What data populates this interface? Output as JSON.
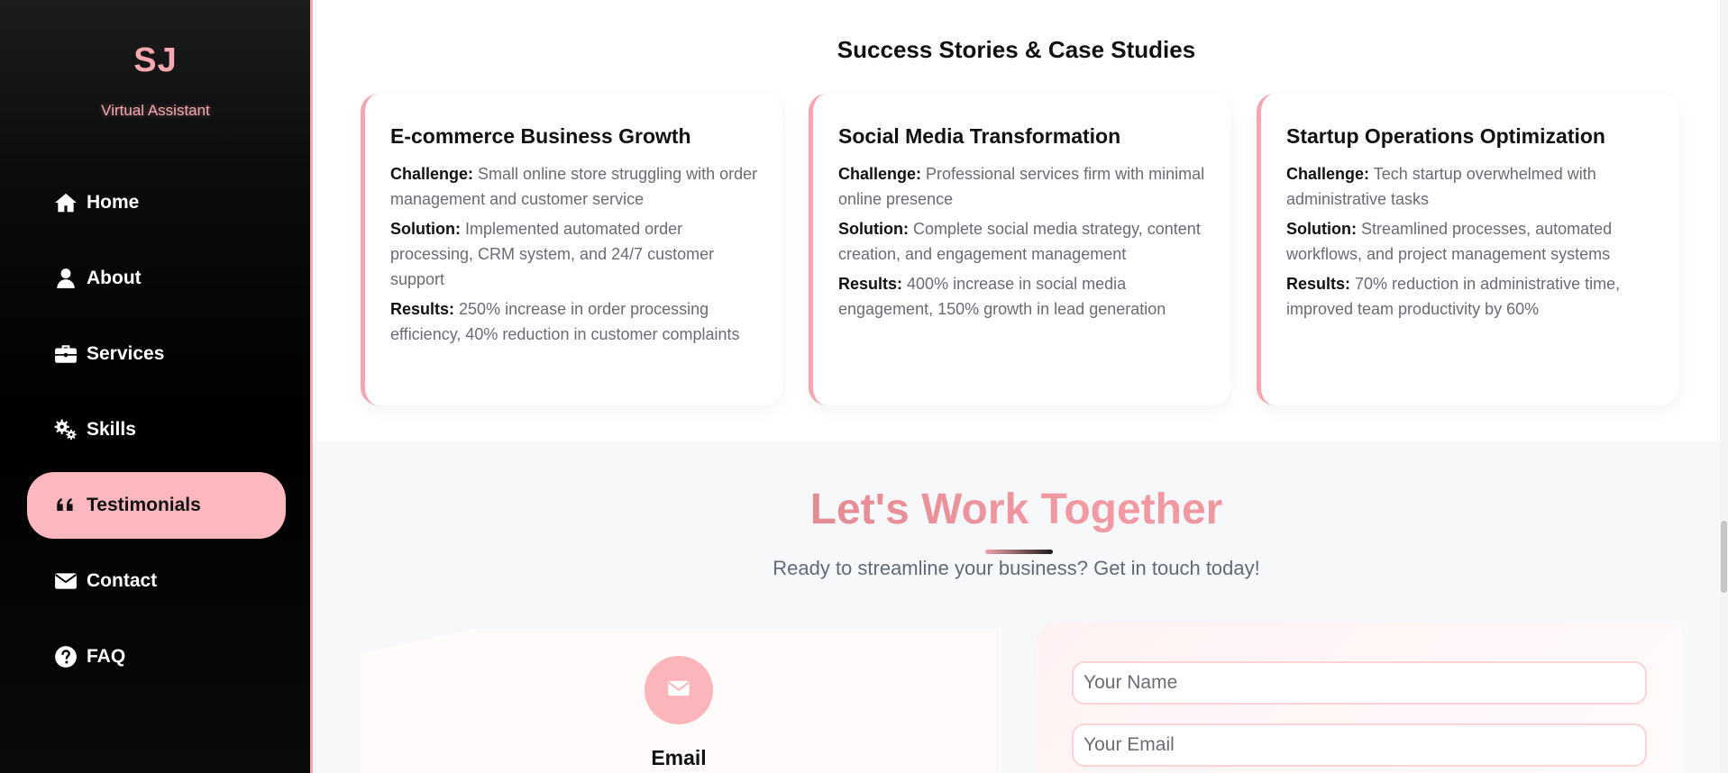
{
  "sidebar": {
    "logo": "SJ",
    "subtitle": "Virtual Assistant",
    "items": [
      {
        "label": "Home",
        "icon": "home-icon"
      },
      {
        "label": "About",
        "icon": "user-icon"
      },
      {
        "label": "Services",
        "icon": "briefcase-icon"
      },
      {
        "label": "Skills",
        "icon": "gears-icon"
      },
      {
        "label": "Testimonials",
        "icon": "quote-icon",
        "active": true
      },
      {
        "label": "Contact",
        "icon": "envelope-icon"
      },
      {
        "label": "FAQ",
        "icon": "question-circle-icon"
      }
    ]
  },
  "case_studies": {
    "title": "Success Stories & Case Studies",
    "cards": [
      {
        "title": "E-commerce Business Growth",
        "challenge_label": "Challenge:",
        "challenge": "Small online store struggling with order management and customer service",
        "solution_label": "Solution:",
        "solution": "Implemented automated order processing, CRM system, and 24/7 customer support",
        "results_label": "Results:",
        "results": "250% increase in order processing efficiency, 40% reduction in customer complaints"
      },
      {
        "title": "Social Media Transformation",
        "challenge_label": "Challenge:",
        "challenge": "Professional services firm with minimal online presence",
        "solution_label": "Solution:",
        "solution": "Complete social media strategy, content creation, and engagement management",
        "results_label": "Results:",
        "results": "400% increase in social media engagement, 150% growth in lead generation"
      },
      {
        "title": "Startup Operations Optimization",
        "challenge_label": "Challenge:",
        "challenge": "Tech startup overwhelmed with administrative tasks",
        "solution_label": "Solution:",
        "solution": "Streamlined processes, automated workflows, and project management systems",
        "results_label": "Results:",
        "results": "70% reduction in administrative time, improved team productivity by 60%"
      }
    ]
  },
  "contact": {
    "title": "Let's Work Together",
    "subtitle": "Ready to streamline your business? Get in touch today!",
    "email_label": "Email",
    "name_placeholder": "Your Name",
    "email_placeholder": "Your Email"
  },
  "colors": {
    "accent": "#f7a8b1",
    "active_nav": "#fdb8bf",
    "sidebar_bg": "#000000"
  }
}
